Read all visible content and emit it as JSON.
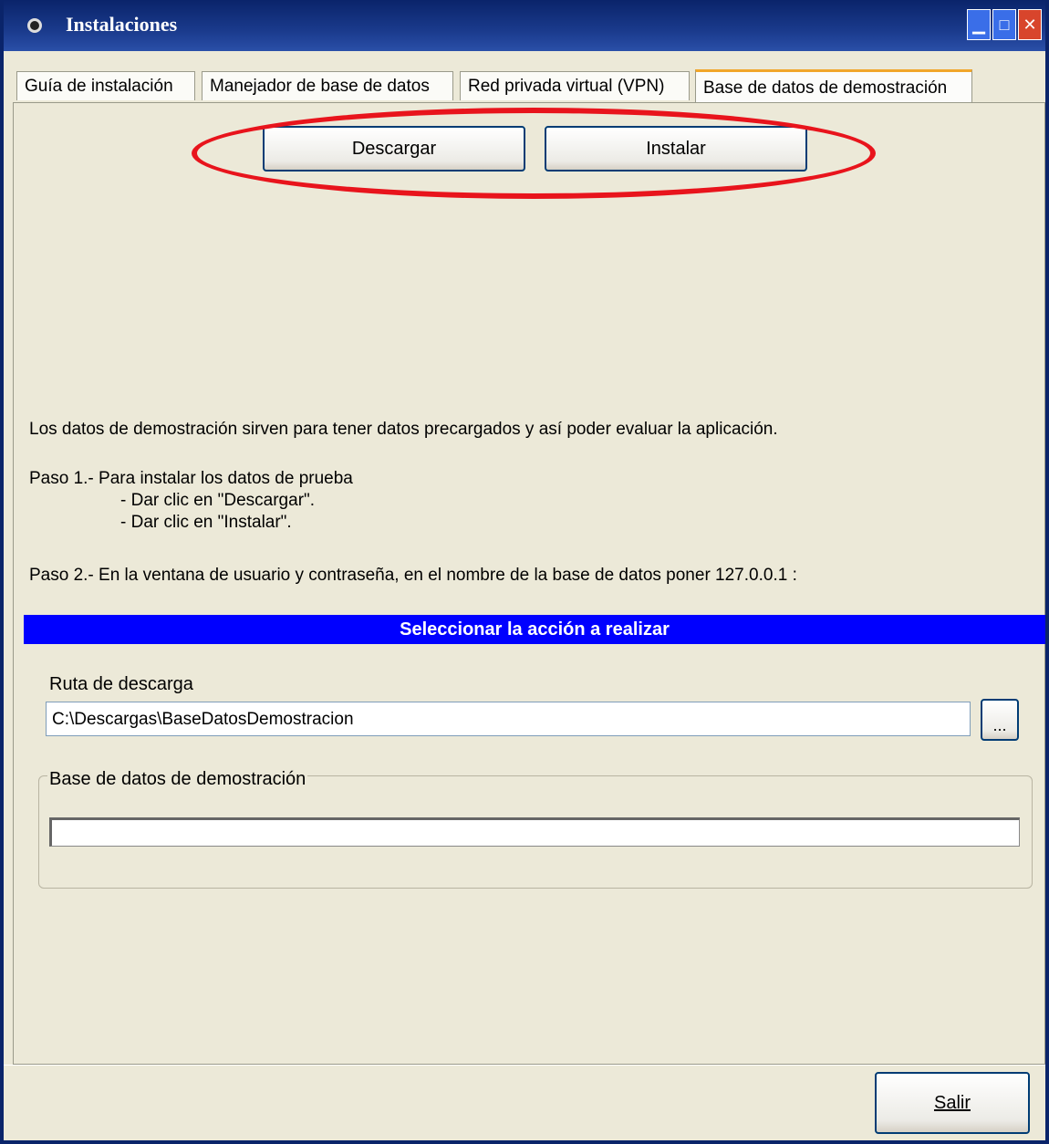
{
  "window": {
    "title": "Instalaciones",
    "controls": {
      "minimize": "▁",
      "maximize": "□",
      "close": "✕"
    }
  },
  "tabs": [
    {
      "label": "Guía de instalación"
    },
    {
      "label": "Manejador de base de datos"
    },
    {
      "label": "Red privada virtual (VPN)"
    },
    {
      "label": "Base de datos de demostración"
    }
  ],
  "actions": {
    "download_label": "Descargar",
    "install_label": "Instalar"
  },
  "instructions": {
    "intro": "Los datos de demostración sirven para tener datos precargados y así poder evaluar la aplicación.",
    "step1_title": "Paso 1.- Para instalar los datos de prueba",
    "step1_a": "- Dar clic en \"Descargar\".",
    "step1_b": "- Dar clic en \"Instalar\".",
    "step2": "Paso 2.- En la ventana de usuario y contraseña, en el nombre de la base de datos poner 127.0.0.1 :"
  },
  "banner": {
    "text": "Seleccionar la acción a realizar"
  },
  "download_path": {
    "label": "Ruta de descarga",
    "value": "C:\\Descargas\\BaseDatosDemostracion",
    "browse_label": "..."
  },
  "demo_group": {
    "legend": "Base de datos de demostración",
    "progress": 0
  },
  "footer": {
    "exit_label": "Salir"
  }
}
